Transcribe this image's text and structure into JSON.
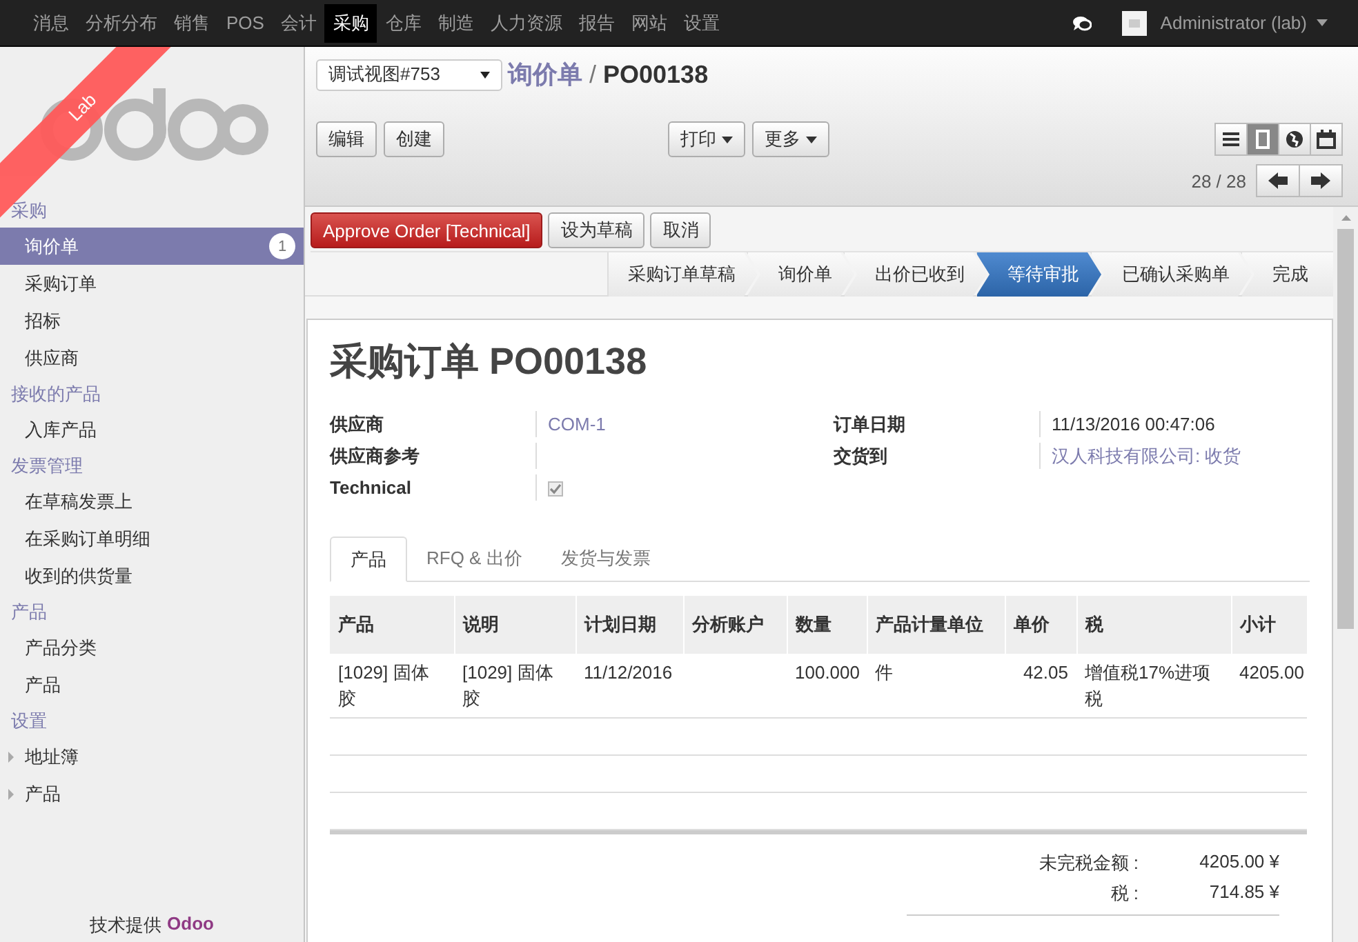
{
  "top_menu": [
    {
      "label": "消息",
      "selected": false
    },
    {
      "label": "分析分布",
      "selected": false
    },
    {
      "label": "销售",
      "selected": false
    },
    {
      "label": "POS",
      "selected": false
    },
    {
      "label": "会计",
      "selected": false
    },
    {
      "label": "采购",
      "selected": true
    },
    {
      "label": "仓库",
      "selected": false
    },
    {
      "label": "制造",
      "selected": false
    },
    {
      "label": "人力资源",
      "selected": false
    },
    {
      "label": "报告",
      "selected": false
    },
    {
      "label": "网站",
      "selected": false
    },
    {
      "label": "设置",
      "selected": false
    }
  ],
  "user": {
    "name": "Administrator (lab)"
  },
  "ribbon": "Lab",
  "sidebar": {
    "sections": [
      {
        "title": "采购",
        "items": [
          {
            "label": "询价单",
            "selected": true,
            "kind": "leaf",
            "badge": "1"
          },
          {
            "label": "采购订单",
            "selected": false,
            "kind": "leaf"
          },
          {
            "label": "招标",
            "selected": false,
            "kind": "leaf"
          },
          {
            "label": "供应商",
            "selected": false,
            "kind": "leaf"
          }
        ]
      },
      {
        "title": "接收的产品",
        "items": [
          {
            "label": "入库产品",
            "selected": false,
            "kind": "leaf"
          }
        ]
      },
      {
        "title": "发票管理",
        "items": [
          {
            "label": "在草稿发票上",
            "selected": false,
            "kind": "leaf"
          },
          {
            "label": "在采购订单明细",
            "selected": false,
            "kind": "leaf"
          },
          {
            "label": "收到的供货量",
            "selected": false,
            "kind": "leaf"
          }
        ]
      },
      {
        "title": "产品",
        "items": [
          {
            "label": "产品分类",
            "selected": false,
            "kind": "leaf"
          },
          {
            "label": "产品",
            "selected": false,
            "kind": "leaf"
          }
        ]
      },
      {
        "title": "设置",
        "items": [
          {
            "label": "地址簿",
            "selected": false,
            "kind": "folder"
          },
          {
            "label": "产品",
            "selected": false,
            "kind": "folder"
          }
        ]
      }
    ],
    "footer": {
      "text": "技术提供",
      "link": "Odoo"
    }
  },
  "debug_view": {
    "value": "调试视图#753"
  },
  "breadcrumb_separator": "/",
  "breadcrumb": [
    {
      "label": "询价单",
      "kind": "link"
    },
    {
      "label": "PO00138",
      "kind": "current"
    }
  ],
  "buttons_left": [
    "编辑",
    "创建"
  ],
  "buttons_center": [
    "打印",
    "更多"
  ],
  "views": [
    {
      "kind": "list",
      "selected": false
    },
    {
      "kind": "form",
      "selected": true
    },
    {
      "kind": "map",
      "selected": false
    },
    {
      "kind": "calendar",
      "selected": false
    }
  ],
  "pager": "28 / 28",
  "action_buttons": [
    {
      "label": "Approve Order [Technical]",
      "kind": "primary"
    },
    {
      "label": "设为草稿",
      "kind": "default"
    },
    {
      "label": "取消",
      "kind": "default"
    }
  ],
  "stages": [
    {
      "label": "采购订单草稿",
      "selected": false
    },
    {
      "label": "询价单",
      "selected": false
    },
    {
      "label": "出价已收到",
      "selected": false
    },
    {
      "label": "等待审批",
      "selected": true
    },
    {
      "label": "已确认采购单",
      "selected": false
    },
    {
      "label": "完成",
      "selected": false
    }
  ],
  "form": {
    "title": "采购订单 PO00138",
    "fields_left": [
      {
        "label": "供应商",
        "kind": "link",
        "value": "COM-1"
      },
      {
        "label": "供应商参考",
        "kind": "text"
      },
      {
        "label": "Technical",
        "kind": "checkbox",
        "checked": true
      }
    ],
    "fields_right": [
      {
        "label": "订单日期",
        "kind": "text",
        "value": "11/13/2016 00:47:06"
      },
      {
        "label": "交货到",
        "kind": "link",
        "value": "汉人科技有限公司: 收货"
      }
    ],
    "tabs": [
      {
        "label": "产品",
        "selected": true
      },
      {
        "label": "RFQ & 出价",
        "selected": false
      },
      {
        "label": "发货与发票",
        "selected": false
      }
    ],
    "table": {
      "columns": [
        "产品",
        "说明",
        "计划日期",
        "分析账户",
        "数量",
        "产品计量单位",
        "单价",
        "税",
        "小计"
      ],
      "rows": [
        [
          "[1029] 固体胶",
          "[1029] 固体胶",
          "11/12/2016",
          "",
          "100.000",
          "件",
          "42.05",
          "增值税17%进项税",
          "4205.00"
        ]
      ]
    },
    "totals": [
      {
        "label": "未完税金额 :",
        "value": "4205.00 ¥"
      },
      {
        "label": "税 :",
        "value": "714.85 ¥"
      }
    ]
  }
}
